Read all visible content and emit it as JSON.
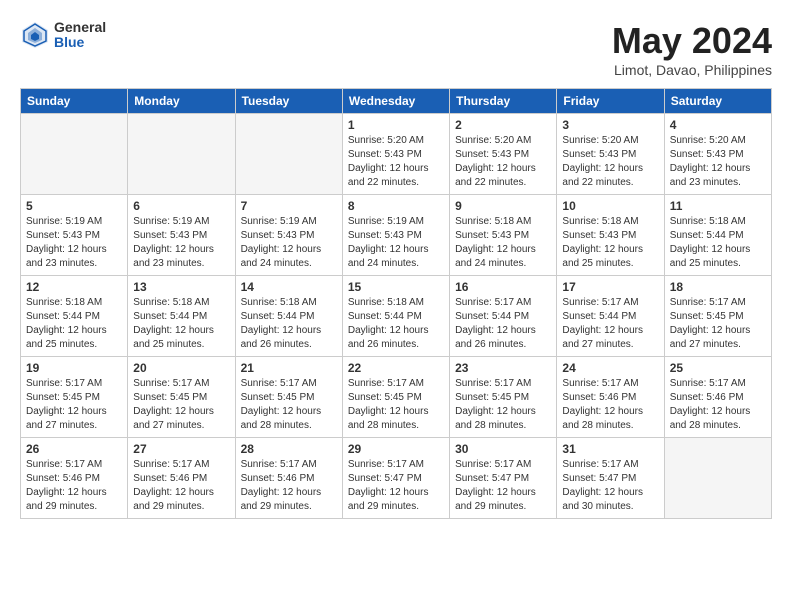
{
  "logo": {
    "general": "General",
    "blue": "Blue"
  },
  "header": {
    "month_year": "May 2024",
    "location": "Limot, Davao, Philippines"
  },
  "weekdays": [
    "Sunday",
    "Monday",
    "Tuesday",
    "Wednesday",
    "Thursday",
    "Friday",
    "Saturday"
  ],
  "weeks": [
    [
      {
        "day": "",
        "sunrise": "",
        "sunset": "",
        "daylight": "",
        "empty": true
      },
      {
        "day": "",
        "sunrise": "",
        "sunset": "",
        "daylight": "",
        "empty": true
      },
      {
        "day": "",
        "sunrise": "",
        "sunset": "",
        "daylight": "",
        "empty": true
      },
      {
        "day": "1",
        "sunrise": "Sunrise: 5:20 AM",
        "sunset": "Sunset: 5:43 PM",
        "daylight": "Daylight: 12 hours and 22 minutes."
      },
      {
        "day": "2",
        "sunrise": "Sunrise: 5:20 AM",
        "sunset": "Sunset: 5:43 PM",
        "daylight": "Daylight: 12 hours and 22 minutes."
      },
      {
        "day": "3",
        "sunrise": "Sunrise: 5:20 AM",
        "sunset": "Sunset: 5:43 PM",
        "daylight": "Daylight: 12 hours and 22 minutes."
      },
      {
        "day": "4",
        "sunrise": "Sunrise: 5:20 AM",
        "sunset": "Sunset: 5:43 PM",
        "daylight": "Daylight: 12 hours and 23 minutes."
      }
    ],
    [
      {
        "day": "5",
        "sunrise": "Sunrise: 5:19 AM",
        "sunset": "Sunset: 5:43 PM",
        "daylight": "Daylight: 12 hours and 23 minutes."
      },
      {
        "day": "6",
        "sunrise": "Sunrise: 5:19 AM",
        "sunset": "Sunset: 5:43 PM",
        "daylight": "Daylight: 12 hours and 23 minutes."
      },
      {
        "day": "7",
        "sunrise": "Sunrise: 5:19 AM",
        "sunset": "Sunset: 5:43 PM",
        "daylight": "Daylight: 12 hours and 24 minutes."
      },
      {
        "day": "8",
        "sunrise": "Sunrise: 5:19 AM",
        "sunset": "Sunset: 5:43 PM",
        "daylight": "Daylight: 12 hours and 24 minutes."
      },
      {
        "day": "9",
        "sunrise": "Sunrise: 5:18 AM",
        "sunset": "Sunset: 5:43 PM",
        "daylight": "Daylight: 12 hours and 24 minutes."
      },
      {
        "day": "10",
        "sunrise": "Sunrise: 5:18 AM",
        "sunset": "Sunset: 5:43 PM",
        "daylight": "Daylight: 12 hours and 25 minutes."
      },
      {
        "day": "11",
        "sunrise": "Sunrise: 5:18 AM",
        "sunset": "Sunset: 5:44 PM",
        "daylight": "Daylight: 12 hours and 25 minutes."
      }
    ],
    [
      {
        "day": "12",
        "sunrise": "Sunrise: 5:18 AM",
        "sunset": "Sunset: 5:44 PM",
        "daylight": "Daylight: 12 hours and 25 minutes."
      },
      {
        "day": "13",
        "sunrise": "Sunrise: 5:18 AM",
        "sunset": "Sunset: 5:44 PM",
        "daylight": "Daylight: 12 hours and 25 minutes."
      },
      {
        "day": "14",
        "sunrise": "Sunrise: 5:18 AM",
        "sunset": "Sunset: 5:44 PM",
        "daylight": "Daylight: 12 hours and 26 minutes."
      },
      {
        "day": "15",
        "sunrise": "Sunrise: 5:18 AM",
        "sunset": "Sunset: 5:44 PM",
        "daylight": "Daylight: 12 hours and 26 minutes."
      },
      {
        "day": "16",
        "sunrise": "Sunrise: 5:17 AM",
        "sunset": "Sunset: 5:44 PM",
        "daylight": "Daylight: 12 hours and 26 minutes."
      },
      {
        "day": "17",
        "sunrise": "Sunrise: 5:17 AM",
        "sunset": "Sunset: 5:44 PM",
        "daylight": "Daylight: 12 hours and 27 minutes."
      },
      {
        "day": "18",
        "sunrise": "Sunrise: 5:17 AM",
        "sunset": "Sunset: 5:45 PM",
        "daylight": "Daylight: 12 hours and 27 minutes."
      }
    ],
    [
      {
        "day": "19",
        "sunrise": "Sunrise: 5:17 AM",
        "sunset": "Sunset: 5:45 PM",
        "daylight": "Daylight: 12 hours and 27 minutes."
      },
      {
        "day": "20",
        "sunrise": "Sunrise: 5:17 AM",
        "sunset": "Sunset: 5:45 PM",
        "daylight": "Daylight: 12 hours and 27 minutes."
      },
      {
        "day": "21",
        "sunrise": "Sunrise: 5:17 AM",
        "sunset": "Sunset: 5:45 PM",
        "daylight": "Daylight: 12 hours and 28 minutes."
      },
      {
        "day": "22",
        "sunrise": "Sunrise: 5:17 AM",
        "sunset": "Sunset: 5:45 PM",
        "daylight": "Daylight: 12 hours and 28 minutes."
      },
      {
        "day": "23",
        "sunrise": "Sunrise: 5:17 AM",
        "sunset": "Sunset: 5:45 PM",
        "daylight": "Daylight: 12 hours and 28 minutes."
      },
      {
        "day": "24",
        "sunrise": "Sunrise: 5:17 AM",
        "sunset": "Sunset: 5:46 PM",
        "daylight": "Daylight: 12 hours and 28 minutes."
      },
      {
        "day": "25",
        "sunrise": "Sunrise: 5:17 AM",
        "sunset": "Sunset: 5:46 PM",
        "daylight": "Daylight: 12 hours and 28 minutes."
      }
    ],
    [
      {
        "day": "26",
        "sunrise": "Sunrise: 5:17 AM",
        "sunset": "Sunset: 5:46 PM",
        "daylight": "Daylight: 12 hours and 29 minutes."
      },
      {
        "day": "27",
        "sunrise": "Sunrise: 5:17 AM",
        "sunset": "Sunset: 5:46 PM",
        "daylight": "Daylight: 12 hours and 29 minutes."
      },
      {
        "day": "28",
        "sunrise": "Sunrise: 5:17 AM",
        "sunset": "Sunset: 5:46 PM",
        "daylight": "Daylight: 12 hours and 29 minutes."
      },
      {
        "day": "29",
        "sunrise": "Sunrise: 5:17 AM",
        "sunset": "Sunset: 5:47 PM",
        "daylight": "Daylight: 12 hours and 29 minutes."
      },
      {
        "day": "30",
        "sunrise": "Sunrise: 5:17 AM",
        "sunset": "Sunset: 5:47 PM",
        "daylight": "Daylight: 12 hours and 29 minutes."
      },
      {
        "day": "31",
        "sunrise": "Sunrise: 5:17 AM",
        "sunset": "Sunset: 5:47 PM",
        "daylight": "Daylight: 12 hours and 30 minutes."
      },
      {
        "day": "",
        "sunrise": "",
        "sunset": "",
        "daylight": "",
        "empty": true
      }
    ]
  ]
}
